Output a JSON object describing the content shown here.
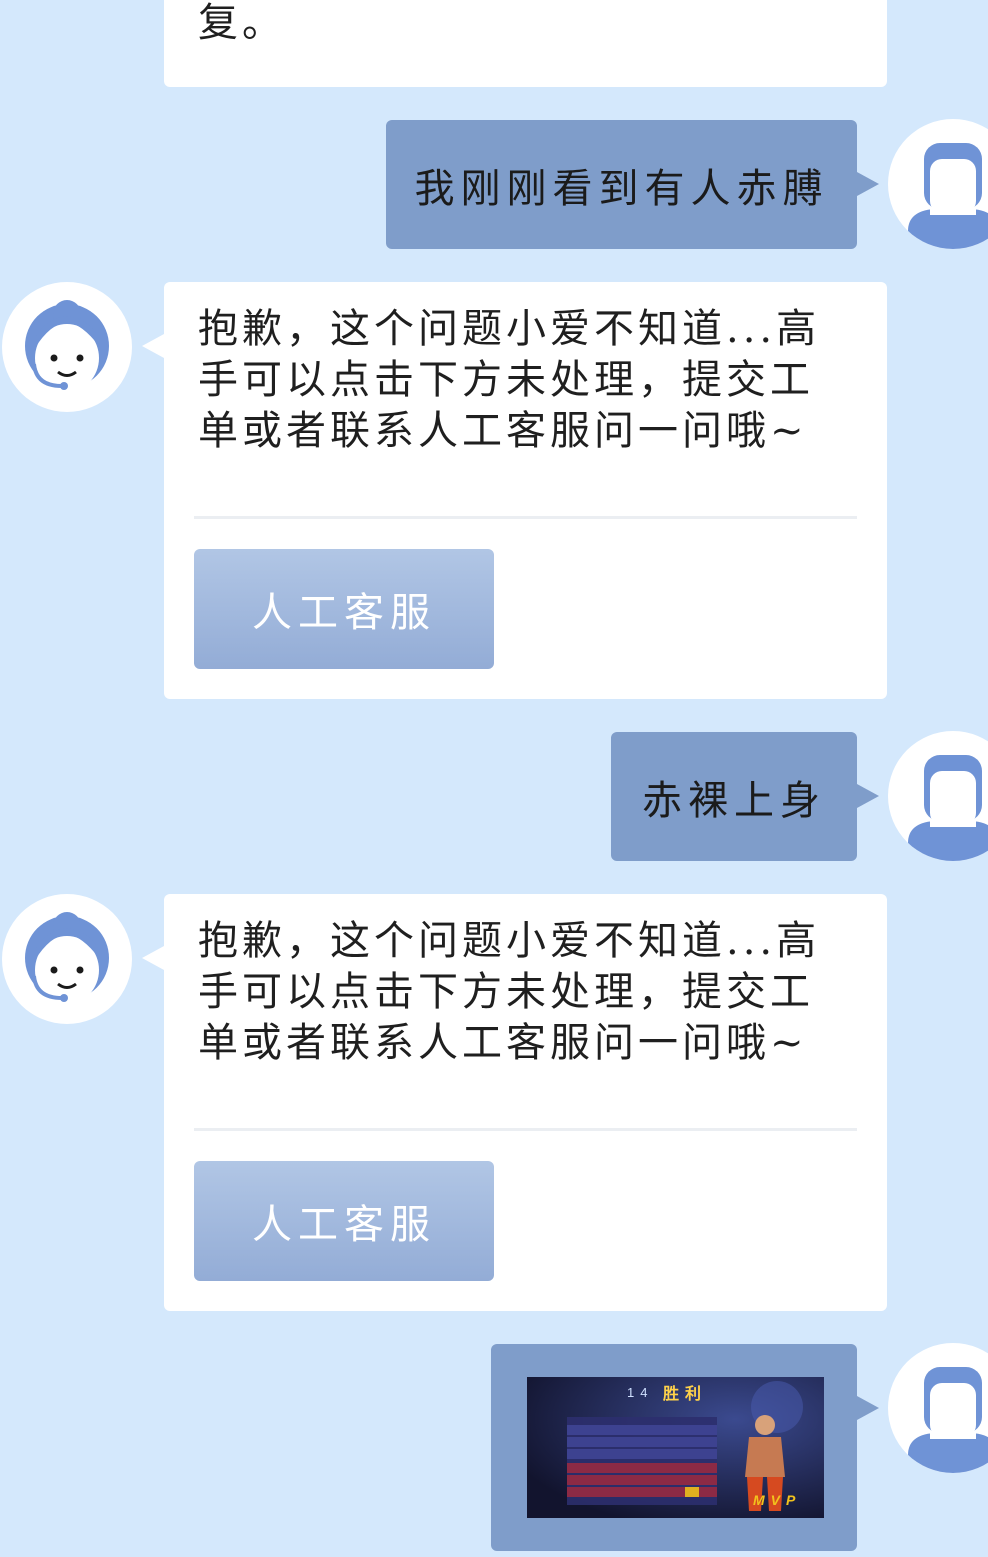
{
  "messages": {
    "top_partial": {
      "text": "复。"
    },
    "user1": {
      "text": "我刚刚看到有人赤膊"
    },
    "bot1": {
      "text": "抱歉，这个问题小爱不知道...高手可以点击下方未处理，提交工单或者联系人工客服问一问哦~",
      "button_label": "人工客服"
    },
    "user2": {
      "text": "赤裸上身"
    },
    "bot2": {
      "text": "抱歉，这个问题小爱不知道...高手可以点击下方未处理，提交工单或者联系人工客服问一问哦~",
      "button_label": "人工客服"
    },
    "user3": {
      "image": {
        "badge": "14",
        "title": "胜利",
        "mvp": "MVP"
      }
    }
  },
  "colors": {
    "background": "#d4e8fc",
    "bot_bubble": "#ffffff",
    "user_bubble": "#7f9dca",
    "button": "#a3badf",
    "avatar_accent": "#6f93d6"
  },
  "icons": {
    "bot_avatar": "customer-service-agent-icon",
    "user_avatar": "user-silhouette-icon"
  }
}
